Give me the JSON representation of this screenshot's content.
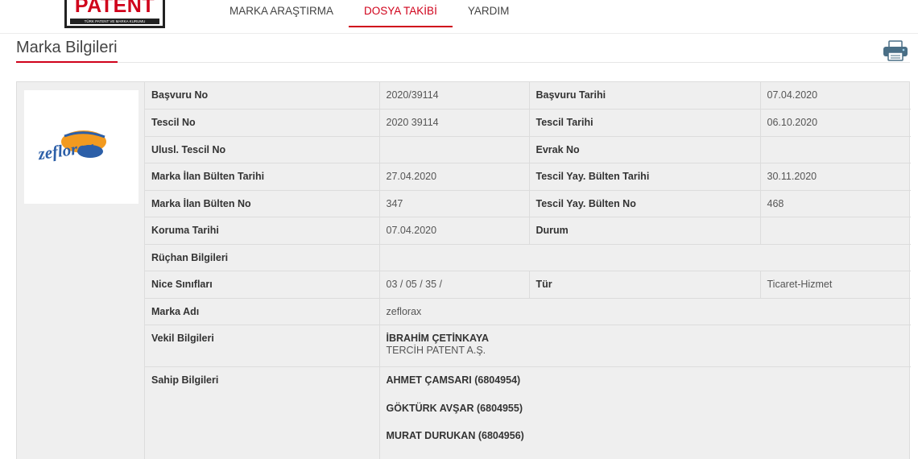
{
  "header": {
    "logo_text": "PATENT",
    "logo_sub": "TÜRK PATENT VE MARKA KURUMU",
    "nav": [
      {
        "label": "MARKA ARAŞTIRMA"
      },
      {
        "label": "DOSYA TAKİBİ",
        "active": true
      },
      {
        "label": "YARDIM"
      }
    ]
  },
  "page": {
    "title": "Marka Bilgileri",
    "print_icon": "printer-icon"
  },
  "brand_logo": {
    "text": "zeflorax",
    "colors": {
      "blue": "#2c5fa8",
      "orange": "#f29a1f"
    }
  },
  "info": {
    "rows": [
      {
        "k1": "Başvuru No",
        "v1": "2020/39114",
        "k2": "Başvuru Tarihi",
        "v2": "07.04.2020"
      },
      {
        "k1": "Tescil No",
        "v1": "2020 39114",
        "k2": "Tescil Tarihi",
        "v2": "06.10.2020"
      },
      {
        "k1": "Ulusl. Tescil No",
        "v1": "",
        "k2": "Evrak No",
        "v2": ""
      },
      {
        "k1": "Marka İlan Bülten Tarihi",
        "v1": "27.04.2020",
        "k2": "Tescil Yay. Bülten Tarihi",
        "v2": "30.11.2020"
      },
      {
        "k1": "Marka İlan Bülten No",
        "v1": "347",
        "k2": "Tescil Yay. Bülten No",
        "v2": "468"
      },
      {
        "k1": "Koruma Tarihi",
        "v1": "07.04.2020",
        "k2": "Durum",
        "v2": ""
      }
    ],
    "ruchan": {
      "label": "Rüçhan Bilgileri",
      "value": ""
    },
    "nice": {
      "label": "Nice Sınıfları",
      "value": "03 / 05 / 35 /",
      "k2": "Tür",
      "v2": "Ticaret-Hizmet"
    },
    "marka_adi": {
      "label": "Marka Adı",
      "value": "zeflorax"
    },
    "vekil": {
      "label": "Vekil Bilgileri",
      "name": "İBRAHİM ÇETİNKAYA",
      "firm": "TERCİH PATENT A.Ş."
    },
    "sahip": {
      "label": "Sahip Bilgileri",
      "owners": [
        "AHMET ÇAMSARI (6804954)",
        "GÖKTÜRK AVŞAR (6804955)",
        "MURAT DURUKAN (6804956)"
      ]
    }
  }
}
